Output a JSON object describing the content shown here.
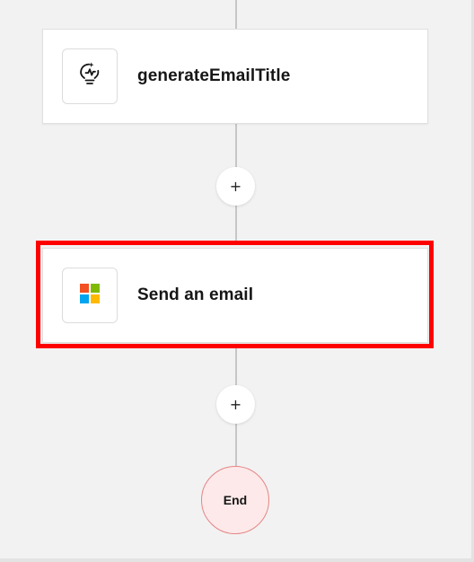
{
  "flow": {
    "steps": [
      {
        "label": "generateEmailTitle",
        "icon": "lightbulb-spark-icon"
      },
      {
        "label": "Send an email",
        "icon": "microsoft-logo-icon",
        "selected": true
      }
    ],
    "add_step_symbol": "+",
    "end_label": "End"
  },
  "colors": {
    "selection": "#ff0000",
    "end_fill": "#fde9e9",
    "end_border": "#e38686",
    "ms_red": "#f25022",
    "ms_green": "#7fba00",
    "ms_blue": "#00a4ef",
    "ms_yellow": "#ffb900"
  }
}
